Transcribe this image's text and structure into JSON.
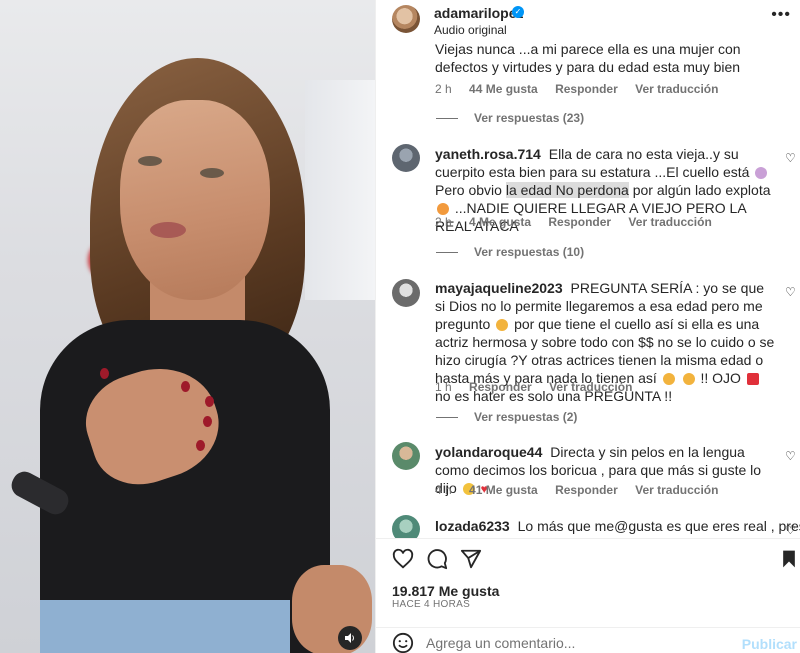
{
  "post": {
    "username": "adamarilopez",
    "subtitle": "Audio original",
    "likes": "19.817 Me gusta",
    "time_ago": "HACE 4 HORAS"
  },
  "comments": [
    {
      "text": "Viejas nunca ...a mi parece ella es una mujer con defectos y virtudes y para du edad esta muy bien",
      "time": "2 h",
      "likes": "44 Me gusta",
      "reply": "Responder",
      "translate": "Ver traducción",
      "view_replies": "Ver respuestas (23)"
    },
    {
      "user": "yaneth.rosa.714",
      "text_a": "Ella de cara no esta vieja..y su cuerpito esta bien para su estatura ...El cuello está",
      "text_b": "Pero obvio",
      "text_highlight": "la edad No perdona",
      "text_c": "por algún lado explota",
      "text_d": "...NADIE QUIERE LLEGAR A VIEJO PERO LA REAL ATACA",
      "time": "2 h",
      "likes": "4 Me gusta",
      "reply": "Responder",
      "translate": "Ver traducción",
      "view_replies": "Ver respuestas (10)"
    },
    {
      "user": "mayajaqueline2023",
      "text_a": "PREGUNTA SERÍA : yo se que si Dios no lo permite llegaremos a esa edad pero me pregunto",
      "text_b": "por que tiene el cuello así si ella es una actriz hermosa y sobre todo con $$ no se lo cuido o se hizo cirugía ?Y otras actrices tienen la misma edad o hasta más y para nada lo tienen así",
      "text_c": "!! OJO",
      "text_d": "no es hater es solo una PREGUNTA !!",
      "time": "1 h",
      "reply": "Responder",
      "translate": "Ver traducción",
      "view_replies": "Ver respuestas (2)"
    },
    {
      "user": "yolandaroque44",
      "text": "Directa y sin pelos en la lengua como decimos los boricua , para que más si guste lo dijo",
      "time": "4 h",
      "likes": "41 Me gusta",
      "reply": "Responder",
      "translate": "Ver traducción"
    },
    {
      "user": "lozada6233",
      "text": "Lo más que me@gusta es que eres real , presenta"
    }
  ],
  "comment_box": {
    "placeholder": "Agrega un comentario...",
    "post_label": "Publicar"
  },
  "icons": {
    "verified": "verified-badge-icon",
    "more": "more-options-icon",
    "like": "heart-icon",
    "comment": "comment-icon",
    "share": "share-icon",
    "save": "bookmark-icon",
    "emoji": "emoji-icon",
    "sound": "speaker-icon"
  },
  "colors": {
    "accent": "#0095f6",
    "muted": "#737373",
    "post_button": "#b2dffc"
  }
}
